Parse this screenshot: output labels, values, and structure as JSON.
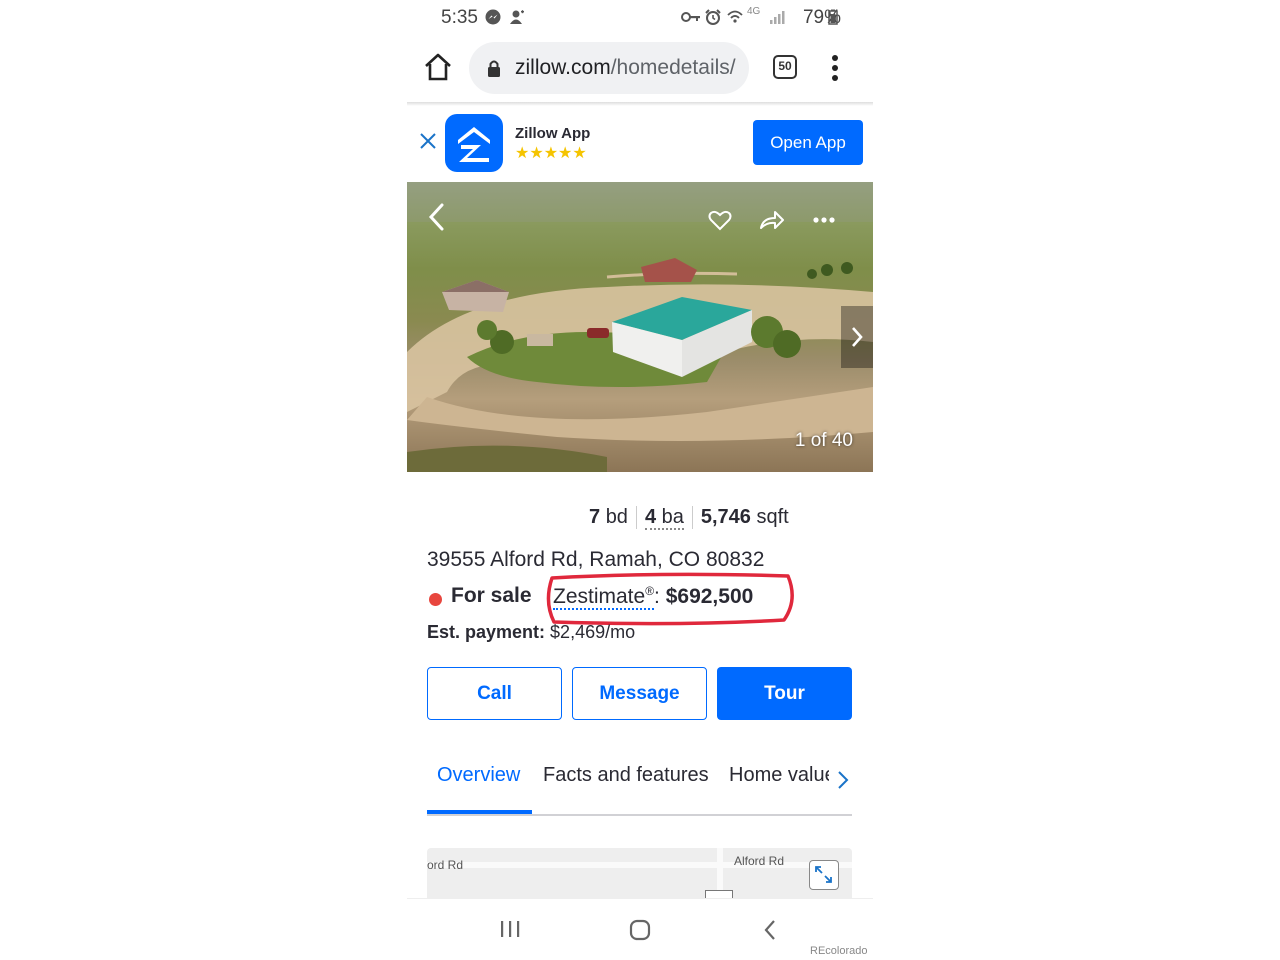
{
  "status_bar": {
    "time": "5:35",
    "network": "4G",
    "battery": "79%"
  },
  "browser": {
    "url_domain": "zillow.com",
    "url_path": "/homedetails/",
    "tab_count": "50"
  },
  "app_banner": {
    "app_name": "Zillow App",
    "stars": "★★★★★",
    "open_label": "Open App"
  },
  "photo": {
    "counter": "1 of 40"
  },
  "listing": {
    "beds_value": "7",
    "beds_unit": "bd",
    "baths_value": "4",
    "baths_unit": "ba",
    "sqft_value": "5,746",
    "sqft_unit": "sqft",
    "address": "39555 Alford Rd, Ramah, CO 80832",
    "status": "For sale",
    "zestimate_label": "Zestimate",
    "zestimate_mark": "®",
    "zestimate_value": "$692,500",
    "est_payment_label": "Est. payment:",
    "est_payment_value": "$2,469/mo"
  },
  "actions": {
    "call": "Call",
    "message": "Message",
    "tour": "Tour"
  },
  "tabs": [
    {
      "label": "Overview"
    },
    {
      "label": "Facts and features"
    },
    {
      "label": "Home value"
    }
  ],
  "map": {
    "road_label_left": "ord Rd",
    "road_label_right": "Alford Rd"
  },
  "watermark": "REcolorado",
  "colors": {
    "brand_blue": "#006aff",
    "for_sale_dot": "#e8463e",
    "annotation_red": "#e0283c"
  }
}
